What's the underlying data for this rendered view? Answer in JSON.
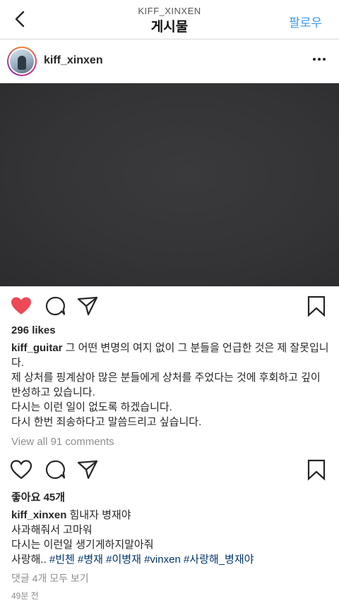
{
  "header": {
    "account": "KIFF_XINXEN",
    "title": "게시물",
    "follow_label": "팔로우"
  },
  "post1": {
    "username": "kiff_xinxen",
    "likes": "296 likes",
    "caption_user": "kiff_guitar",
    "caption_lines": [
      " 그 어떤 변명의 여지 없이 그 분들을 언급한 것은 제 잘못입니다.",
      "제 상처를 핑계삼아 많은 분들에게 상처를 주었다는 것에 후회하고 깊이 반성하고 있습니다.",
      "다시는 이런 일이 없도록 하겠습니다.",
      "다시 한번 죄송하다고 말씀드리고 싶습니다."
    ],
    "view_comments": "View all 91 comments"
  },
  "post2": {
    "likes": "좋아요 45개",
    "caption_user": "kiff_xinxen",
    "caption_lines": [
      " 힘내자 병재야",
      "사과해줘서 고마워",
      "다시는 이런일 생기게하지말아줘"
    ],
    "caption_prefix": "사랑해.. ",
    "hashtags": [
      "#빈첸",
      "#병재",
      "#이병재",
      "#vinxen",
      "#사랑해_병재야"
    ],
    "view_comments": "댓글 4개 모두 보기",
    "timestamp": "49분 전"
  },
  "icons": {
    "liked_color": "#ed4956",
    "link_color": "#3897f0"
  }
}
